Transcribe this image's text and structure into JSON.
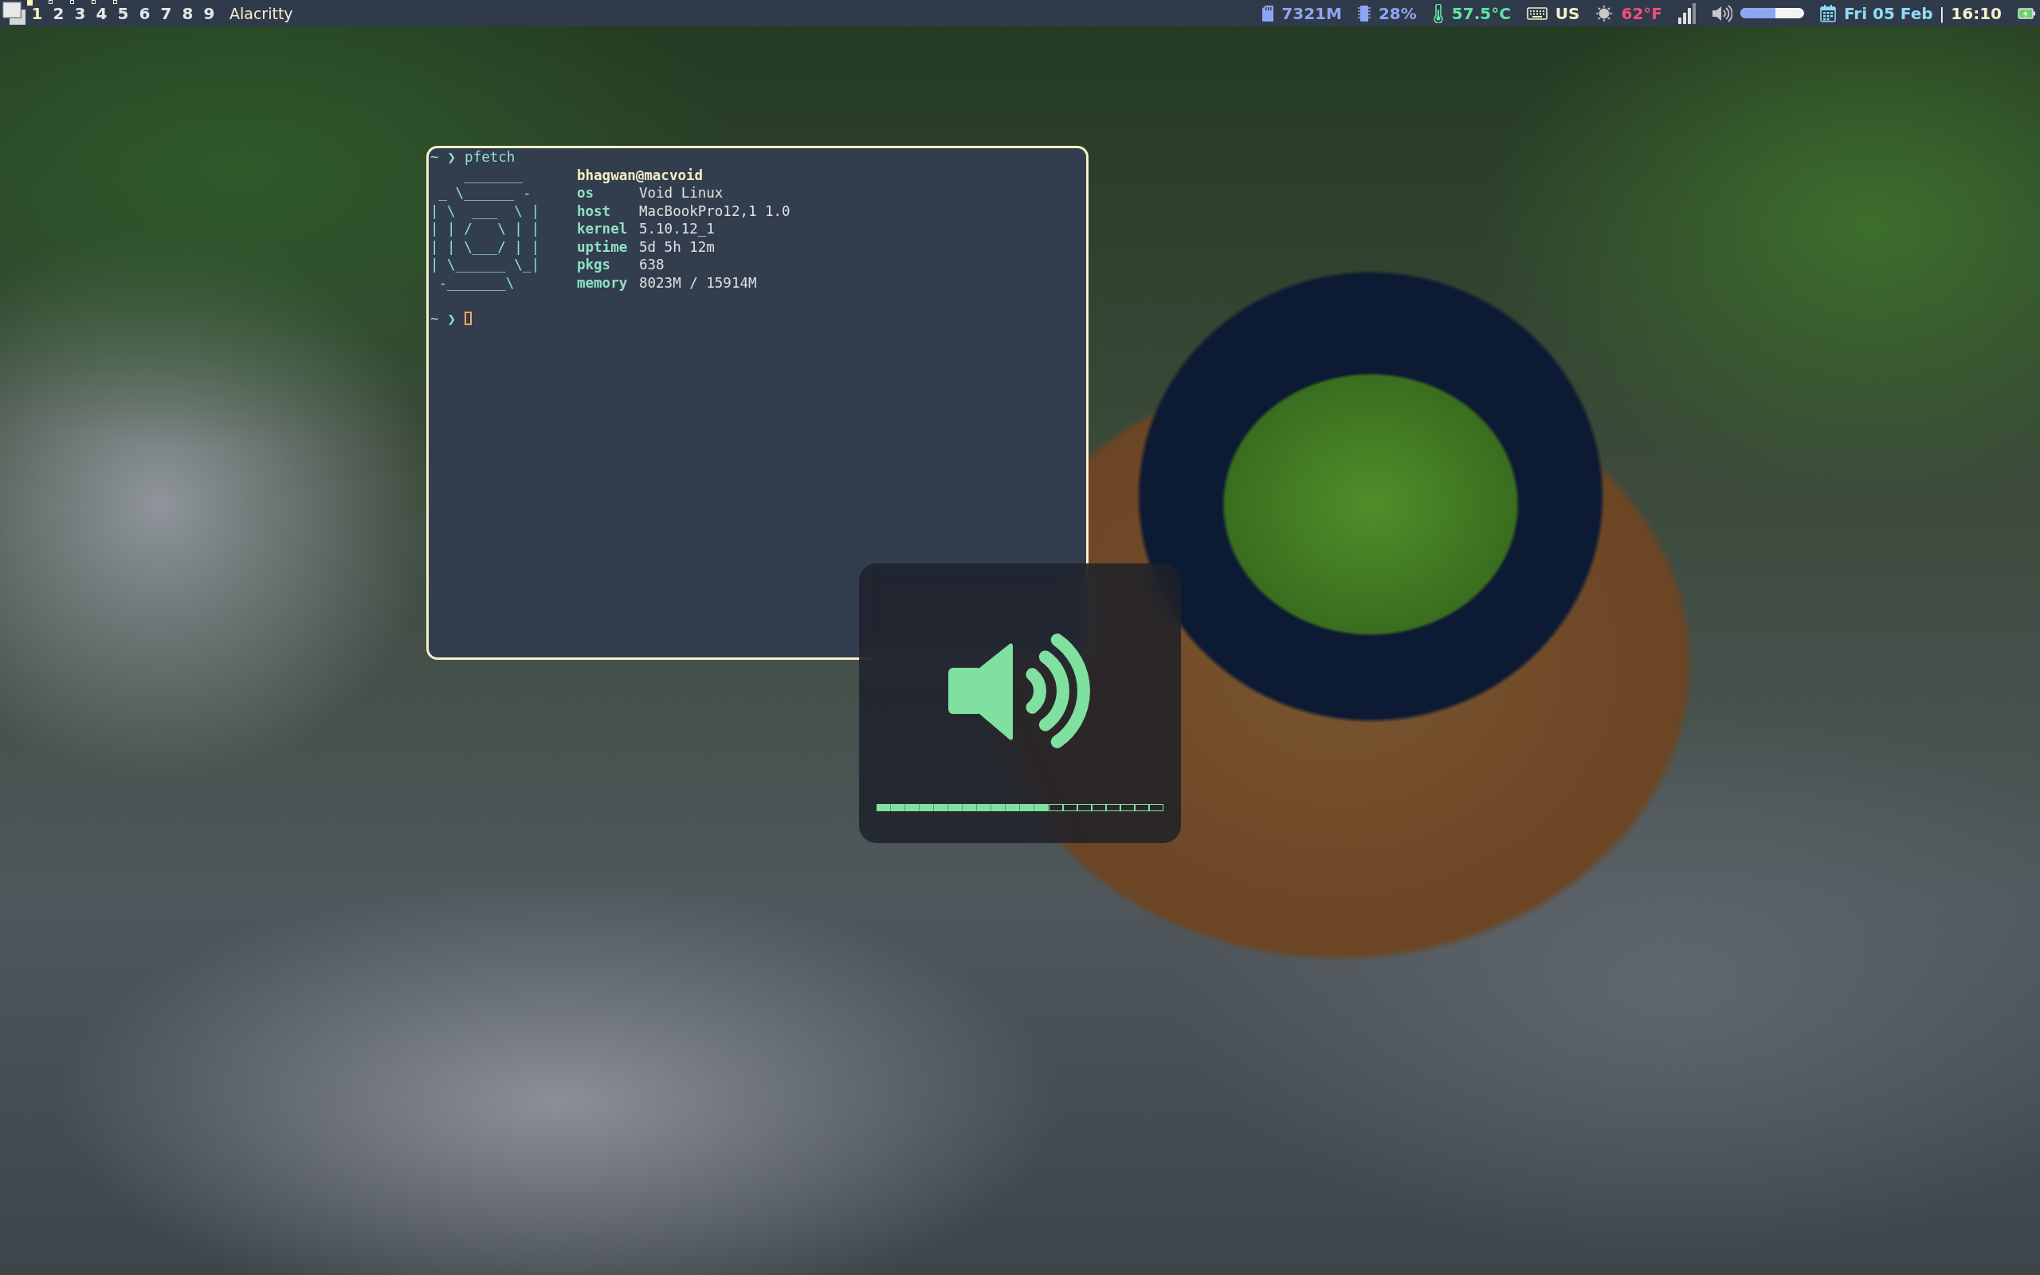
{
  "top_bar": {
    "workspaces": [
      {
        "label": "1",
        "selected": true,
        "occupied": true
      },
      {
        "label": "2",
        "selected": false,
        "occupied": true
      },
      {
        "label": "3",
        "selected": false,
        "occupied": true
      },
      {
        "label": "4",
        "selected": false,
        "occupied": true
      },
      {
        "label": "5",
        "selected": false,
        "occupied": true
      },
      {
        "label": "6",
        "selected": false,
        "occupied": false
      },
      {
        "label": "7",
        "selected": false,
        "occupied": false
      },
      {
        "label": "8",
        "selected": false,
        "occupied": false
      },
      {
        "label": "9",
        "selected": false,
        "occupied": false
      }
    ],
    "window_title": "Alacritty",
    "status": [
      {
        "kind": "memory",
        "text": "7321M"
      },
      {
        "kind": "cpu",
        "text": "28%"
      },
      {
        "kind": "temperature",
        "text": "57.5°C"
      },
      {
        "kind": "keyboard",
        "text": "US"
      },
      {
        "kind": "weather",
        "text": "62°F"
      },
      {
        "kind": "signal"
      },
      {
        "kind": "volume",
        "level": 0.55
      },
      {
        "kind": "date",
        "text": "Fri 05 Feb"
      },
      {
        "kind": "separator",
        "text": "|"
      },
      {
        "kind": "time",
        "text": "16:10"
      },
      {
        "kind": "battery"
      }
    ]
  },
  "terminal": {
    "command_prompt": {
      "cwd": "~",
      "symbol": "❯",
      "command": "pfetch"
    },
    "logo": "    _______\n _ \\______ -\n| \\  ___  \\ |\n| | /   \\ | |\n| | \\___/ | |\n| \\______ \\_|\n -_______\\",
    "user_host": "bhagwan@macvoid",
    "info": [
      {
        "key": "os",
        "value": "Void Linux"
      },
      {
        "key": "host",
        "value": "MacBookPro12,1 1.0"
      },
      {
        "key": "kernel",
        "value": "5.10.12_1"
      },
      {
        "key": "uptime",
        "value": "5d 5h 12m"
      },
      {
        "key": "pkgs",
        "value": "638"
      },
      {
        "key": "memory",
        "value": "8023M / 15914M"
      }
    ],
    "input_prompt": {
      "cwd": "~",
      "symbol": "❯"
    }
  },
  "volume_osd": {
    "level": 0.6
  }
}
